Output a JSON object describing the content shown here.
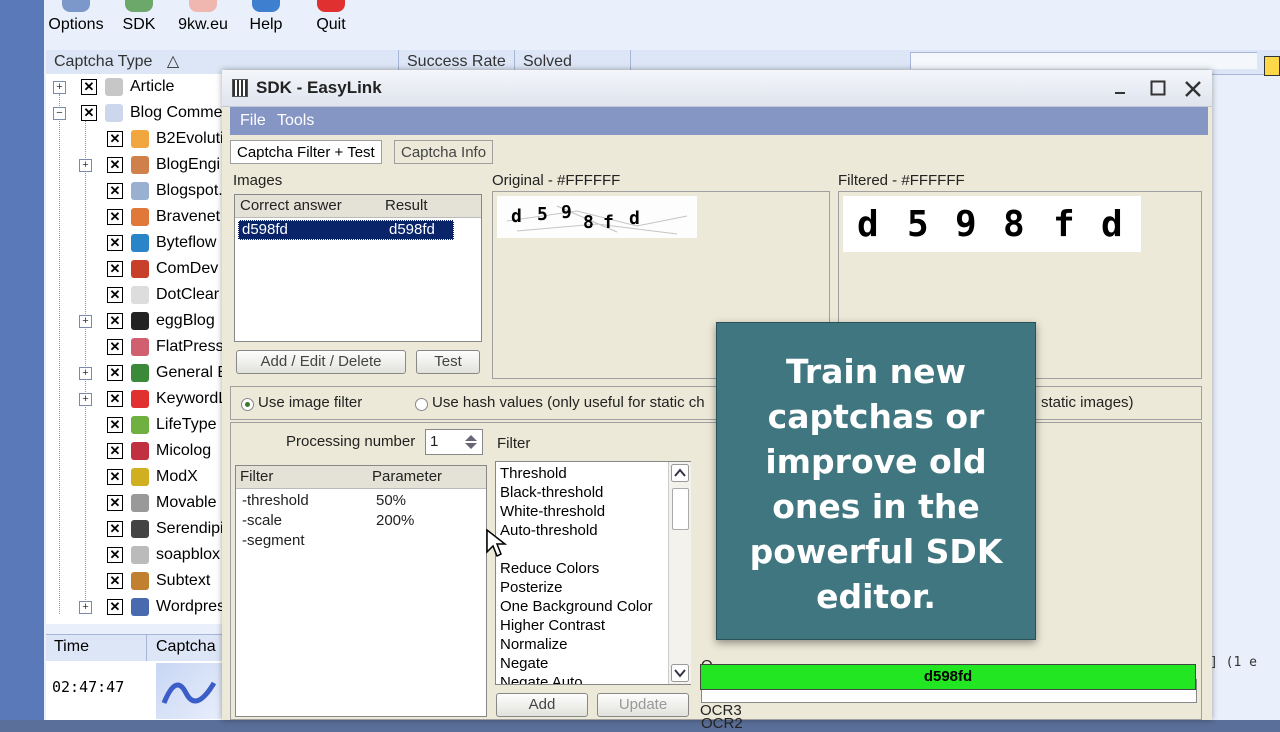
{
  "toolbar": {
    "options": "Options",
    "sdk": "SDK",
    "site": "9kw.eu",
    "help": "Help",
    "quit": "Quit"
  },
  "main_columns": {
    "captcha_type": "Captcha Type",
    "sort_indicator": "△",
    "success_rate": "Success Rate",
    "solved": "Solved"
  },
  "tree": {
    "items": [
      {
        "label": "Article",
        "expander": "+"
      },
      {
        "label": "Blog Commen",
        "expander": "−"
      },
      {
        "label": "B2Evoluti",
        "expander": ""
      },
      {
        "label": "BlogEngi",
        "expander": "+"
      },
      {
        "label": "Blogspot.",
        "expander": ""
      },
      {
        "label": "Bravenet",
        "expander": ""
      },
      {
        "label": "Byteflow",
        "expander": ""
      },
      {
        "label": "ComDev",
        "expander": ""
      },
      {
        "label": "DotClear",
        "expander": ""
      },
      {
        "label": "eggBlog",
        "expander": "+"
      },
      {
        "label": "FlatPress",
        "expander": ""
      },
      {
        "label": "General B",
        "expander": "+"
      },
      {
        "label": "KeywordL",
        "expander": "+"
      },
      {
        "label": "LifeType",
        "expander": ""
      },
      {
        "label": "Micolog",
        "expander": ""
      },
      {
        "label": "ModX",
        "expander": ""
      },
      {
        "label": "Movable",
        "expander": ""
      },
      {
        "label": "Serendipi",
        "expander": ""
      },
      {
        "label": "soapblox",
        "expander": ""
      },
      {
        "label": "Subtext",
        "expander": ""
      },
      {
        "label": "Wordpres",
        "expander": "+"
      }
    ],
    "checkbox_mark": "✕"
  },
  "log": {
    "col_time": "Time",
    "col_captcha": "Captcha",
    "time_value": "02:47:47"
  },
  "sdk": {
    "title": "SDK - EasyLink",
    "menu": {
      "file": "File",
      "tools": "Tools"
    },
    "tabs": {
      "filter_test": "Captcha Filter + Test",
      "info": "Captcha Info"
    },
    "images": {
      "title": "Images",
      "col_answer": "Correct answer",
      "col_result": "Result",
      "rows": [
        {
          "answer": "d598fd",
          "result": "d598fd"
        }
      ],
      "btn_add_edit_delete": "Add / Edit / Delete",
      "btn_test": "Test"
    },
    "original_title": "Original - #FFFFFF",
    "original_chars": [
      "d",
      "5",
      "9",
      "8",
      "f",
      "d"
    ],
    "filtered_title": "Filtered - #FFFFFF",
    "filtered_chars": [
      "d",
      "5",
      "9",
      "8",
      "f",
      "d"
    ],
    "mode": {
      "use_image_filter": "Use image filter",
      "use_hash": "Use hash values (only useful for static ch",
      "use_hash_tail": "static images)"
    },
    "processing": {
      "label": "Processing number",
      "value": "1"
    },
    "filter_table": {
      "col_filter": "Filter",
      "col_param": "Parameter",
      "rows": [
        {
          "filter": "-threshold",
          "param": "50%"
        },
        {
          "filter": "-scale",
          "param": "200%"
        },
        {
          "filter": "-segment",
          "param": ""
        }
      ]
    },
    "filter_list": {
      "title": "Filter",
      "items": [
        "Threshold",
        "Black-threshold",
        "White-threshold",
        "Auto-threshold",
        "",
        "Reduce Colors",
        "Posterize",
        "One Background Color",
        "Higher Contrast",
        "Normalize",
        "Negate",
        "Negate Auto"
      ],
      "btn_add": "Add",
      "btn_update": "Update"
    },
    "ocr": {
      "ocr1_label_partial": "O",
      "ocr2_label": "OCR2",
      "ocr2_value": "d598fd",
      "ocr3_label": "OCR3",
      "ocr2_color": "#22e622",
      "right_edge_text": "] (1 e"
    }
  },
  "overlay": {
    "text": "Train new\ncaptchas or\nimprove old\nones in the\npowerful SDK\neditor."
  },
  "colors": {
    "menubar": "#8595c4",
    "overlay_bg": "#3f7680",
    "selection": "#0a246a"
  }
}
